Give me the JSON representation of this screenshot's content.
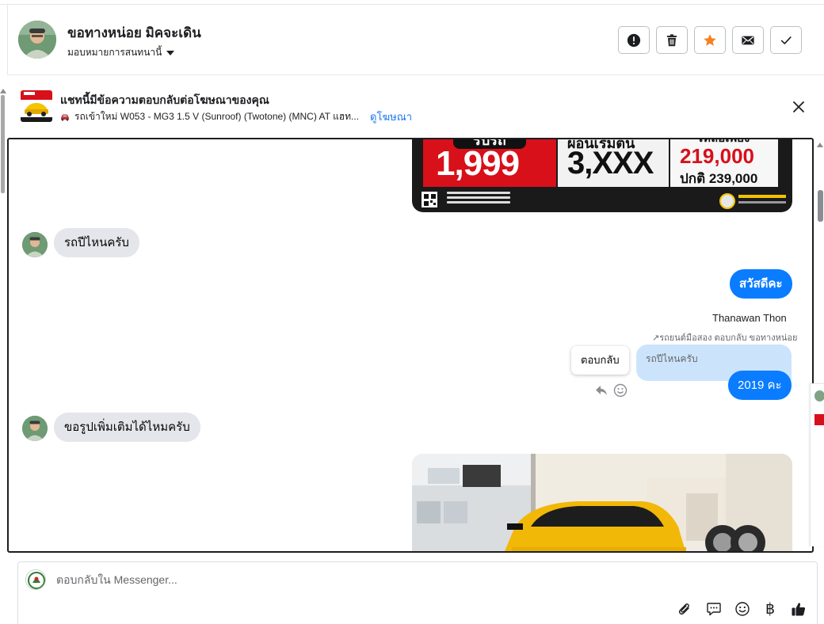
{
  "header": {
    "contact_name": "ขอทางหน่อย มิคจะเดิน",
    "assign_label": "มอบหมายการสนทนานี้",
    "buttons": [
      {
        "name": "report-button",
        "icon": "exclamation-circle-icon"
      },
      {
        "name": "delete-button",
        "icon": "trash-icon"
      },
      {
        "name": "star-button",
        "icon": "star-icon",
        "color": "#f58220"
      },
      {
        "name": "mark-unread-button",
        "icon": "envelope-icon"
      },
      {
        "name": "mark-done-button",
        "icon": "check-icon"
      }
    ]
  },
  "ad_banner": {
    "title": "แชทนี้มีข้อความตอบกลับต่อโฆษณาของคุณ",
    "subtitle": "รถเข้าใหม่ W053 - MG3 1.5 V (Sunroof) (Twotone) (MNC) AT แฮท...",
    "link": "ดูโฆษณา"
  },
  "promo": {
    "label_top": "รับรถ",
    "price1": "1,999",
    "mid_top": "ผ่อนเริ่มต้น",
    "price2": "3,XXX",
    "right_top": "เหลือเพียง",
    "right_price": "219,000",
    "right_normal": "ปกติ 239,000"
  },
  "messages": {
    "in_1": "รถปีไหนครับ",
    "out_1": "สวัสดีคะ",
    "sender": "Thanawan Thon",
    "reply_meta": "รถยนต์มือสอง ตอบกลับ ขอทางหน่อย",
    "quoted": "รถปีไหนครับ",
    "out_2": "2019 คะ",
    "tooltip": "ตอบกลับ",
    "in_2": "ขอรูปเพิ่มเติมได้ไหมครับ"
  },
  "composer": {
    "placeholder": "ตอบกลับใน Messenger...",
    "baht_symbol": "฿"
  },
  "colors": {
    "accent": "#0a7cff",
    "link": "#1877f2",
    "star": "#f58220",
    "incoming_bubble": "#e4e6eb",
    "quoted_bubble": "#cce4fb"
  }
}
